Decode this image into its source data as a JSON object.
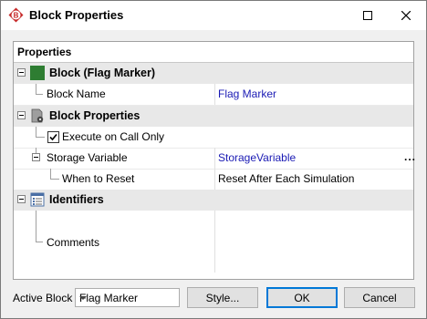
{
  "window": {
    "title": "Block Properties"
  },
  "panel": {
    "header": "Properties"
  },
  "grid": {
    "cat_block": "Block (Flag Marker)",
    "block_name_label": "Block Name",
    "block_name_value": "Flag Marker",
    "cat_block_props": "Block Properties",
    "execute_label": "Execute on Call Only",
    "execute_checked": true,
    "storage_label": "Storage Variable",
    "storage_value": "StorageVariable",
    "when_reset_label": "When to Reset",
    "when_reset_value": "Reset After Each Simulation",
    "cat_identifiers": "Identifiers",
    "comments_label": "Comments",
    "comments_value": "",
    "ellipsis": "..."
  },
  "footer": {
    "active_block_label": "Active Block",
    "active_block_value": "Flag Marker",
    "style_button": "Style...",
    "ok_button": "OK",
    "cancel_button": "Cancel"
  },
  "colors": {
    "link_blue": "#1a1ab4",
    "accent": "#0078d7",
    "flag_green": "#2e7d32"
  }
}
